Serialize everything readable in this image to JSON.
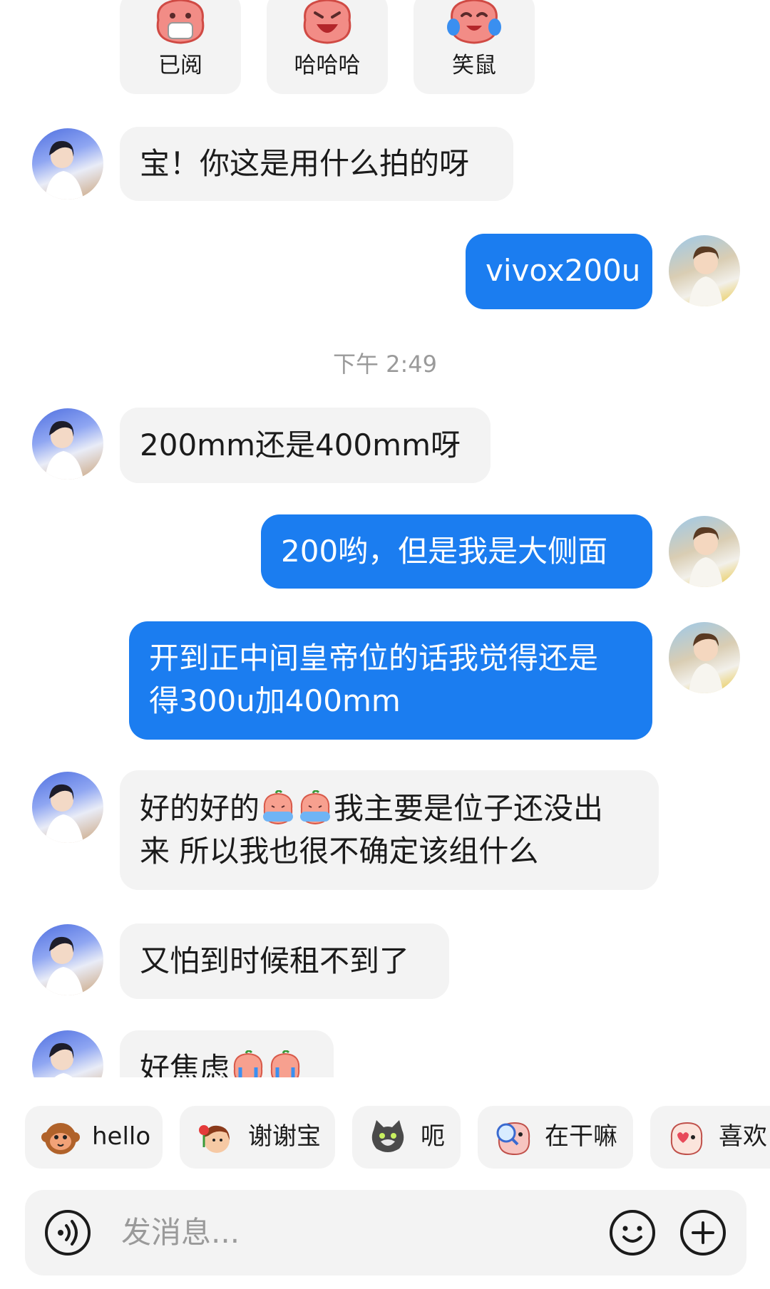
{
  "stickers": [
    {
      "label": "已阅",
      "icon": "peach-mask-sticker"
    },
    {
      "label": "哈哈哈",
      "icon": "peach-laugh-sticker"
    },
    {
      "label": "笑鼠",
      "icon": "peach-cry-laugh-sticker"
    }
  ],
  "messages": [
    {
      "side": "in",
      "text": "宝！你这是用什么拍的呀"
    },
    {
      "side": "out",
      "text": "vivox200u"
    },
    {
      "side": "in",
      "text": "200mm还是400mm呀"
    },
    {
      "side": "out",
      "text": "200哟，但是我是大侧面"
    },
    {
      "side": "out",
      "line1": "开到正中间皇帝位的话我觉得还是",
      "line2": "得300u加400mm"
    },
    {
      "side": "in",
      "line1_a": "好的好的",
      "line1_b": "我主要是位子还没出",
      "line2": "来 所以我也很不确定该组什么"
    },
    {
      "side": "in",
      "text": "又怕到时候租不到了"
    },
    {
      "side": "in",
      "text": "好焦虑"
    }
  ],
  "timestamp": "下午 2:49",
  "quick_replies": [
    {
      "label": "hello",
      "icon": "monkey-face-icon"
    },
    {
      "label": "谢谢宝",
      "icon": "flower-girl-icon"
    },
    {
      "label": "呃",
      "icon": "gray-cat-icon"
    },
    {
      "label": "在干嘛",
      "icon": "magnifier-peach-icon"
    },
    {
      "label": "喜欢",
      "icon": "heart-peach-icon"
    }
  ],
  "input": {
    "placeholder": "发消息..."
  },
  "colors": {
    "outgoing_bubble": "#1b7df0",
    "incoming_bubble": "#f3f3f3"
  }
}
